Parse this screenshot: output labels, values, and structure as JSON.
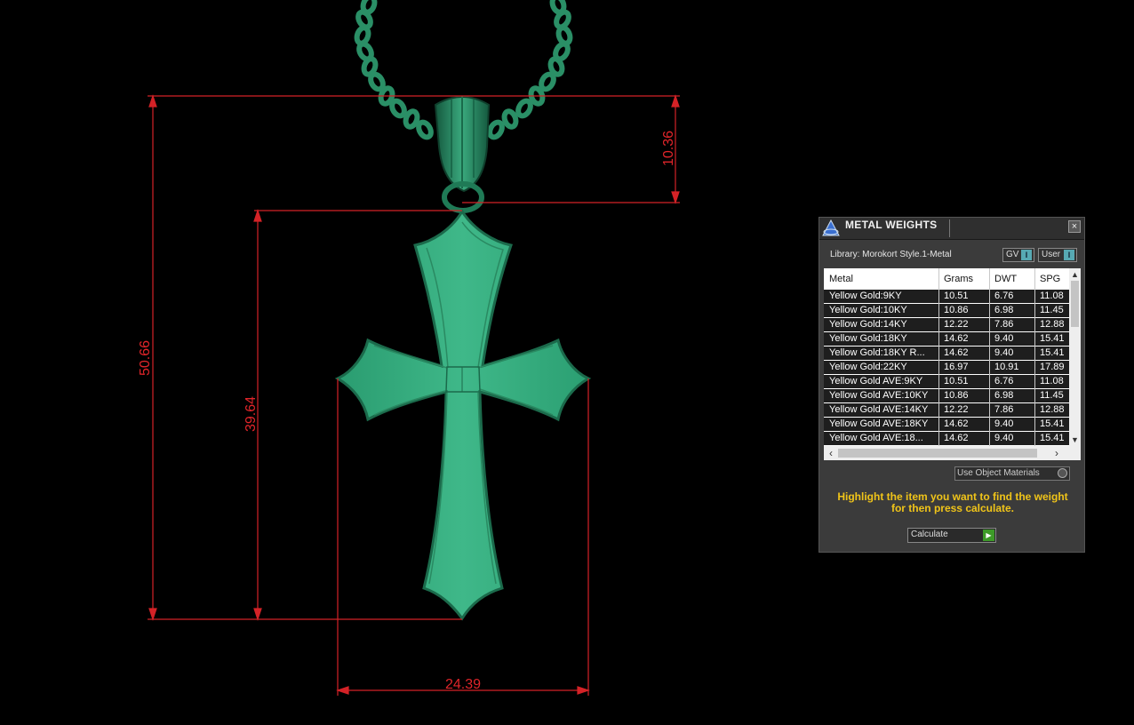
{
  "viewport": {
    "dimension_labels": {
      "bail_height": "10.36",
      "total_height": "50.66",
      "cross_height": "39.64",
      "cross_width": "24.39"
    },
    "colors": {
      "background": "#000000",
      "model": "#3bb384",
      "model_dark": "#1f6e4f",
      "dimension": "#e0252a"
    }
  },
  "panel": {
    "title": "METAL WEIGHTS",
    "close_icon": "×",
    "library_label": "Library: Morokort Style.1-Metal",
    "toggles": {
      "gv_label": "GV",
      "gv_switch": "I",
      "user_label": "User",
      "user_switch": "I"
    },
    "table": {
      "headers": [
        "Metal",
        "Grams",
        "DWT",
        "SPG"
      ],
      "rows": [
        [
          "Yellow Gold:9KY",
          "10.51",
          "6.76",
          "11.08"
        ],
        [
          "Yellow Gold:10KY",
          "10.86",
          "6.98",
          "11.45"
        ],
        [
          "Yellow Gold:14KY",
          "12.22",
          "7.86",
          "12.88"
        ],
        [
          "Yellow Gold:18KY",
          "14.62",
          "9.40",
          "15.41"
        ],
        [
          "Yellow Gold:18KY R...",
          "14.62",
          "9.40",
          "15.41"
        ],
        [
          "Yellow Gold:22KY",
          "16.97",
          "10.91",
          "17.89"
        ],
        [
          "Yellow Gold AVE:9KY",
          "10.51",
          "6.76",
          "11.08"
        ],
        [
          "Yellow Gold AVE:10KY",
          "10.86",
          "6.98",
          "11.45"
        ],
        [
          "Yellow Gold AVE:14KY",
          "12.22",
          "7.86",
          "12.88"
        ],
        [
          "Yellow Gold AVE:18KY",
          "14.62",
          "9.40",
          "15.41"
        ],
        [
          "Yellow Gold AVE:18...",
          "14.62",
          "9.40",
          "15.41"
        ]
      ]
    },
    "scroll_icons": {
      "up": "▲",
      "down": "▼",
      "left": "‹",
      "right": "›"
    },
    "use_object_materials": "Use Object Materials",
    "instructions": "Highlight the item you want to find the weight for then press calculate.",
    "calculate_label": "Calculate",
    "calculate_icon": "▶"
  }
}
